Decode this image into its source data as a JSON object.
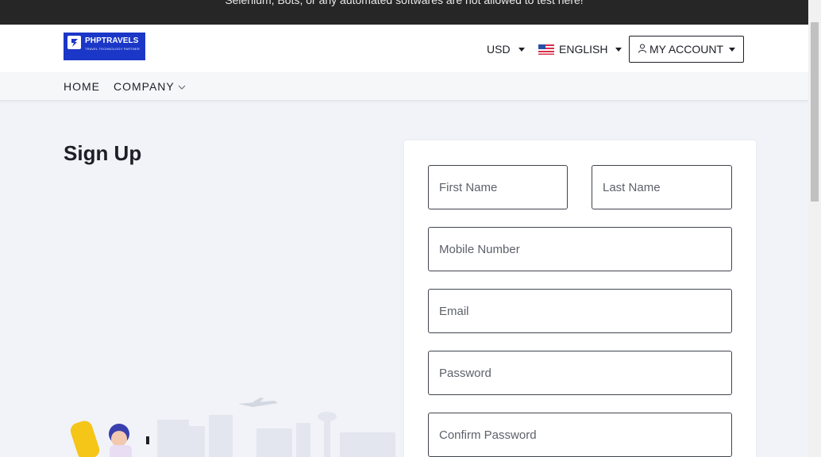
{
  "notice": {
    "text": "Selenium, Bots, or any automated softwares are not allowed to test here!"
  },
  "header": {
    "logo": {
      "name": "PHPTRAVELS",
      "tagline": "TRAVEL TECHNOLOGY PARTNER"
    },
    "currency": "USD",
    "language": "ENGLISH",
    "account": "MY ACCOUNT"
  },
  "nav": {
    "items": [
      {
        "label": "HOME"
      },
      {
        "label": "COMPANY"
      }
    ]
  },
  "page": {
    "title": "Sign Up"
  },
  "form": {
    "first_name": {
      "placeholder": "First Name",
      "value": ""
    },
    "last_name": {
      "placeholder": "Last Name",
      "value": ""
    },
    "mobile": {
      "placeholder": "Mobile Number",
      "value": ""
    },
    "email": {
      "placeholder": "Email",
      "value": ""
    },
    "password": {
      "placeholder": "Password",
      "value": ""
    },
    "confirm_password": {
      "placeholder": "Confirm Password",
      "value": ""
    }
  },
  "colors": {
    "notice_bg": "#262626",
    "brand": "#1a37c7",
    "page_bg": "#f1f3f9",
    "border": "#40444d"
  },
  "icons": {
    "currency_caret": "chevron-down-icon",
    "language_flag": "us-flag-icon",
    "account_user": "user-icon",
    "company_chevron": "chevron-down-icon"
  }
}
